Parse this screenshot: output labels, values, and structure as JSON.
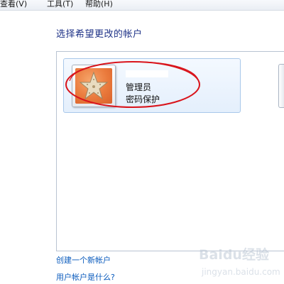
{
  "menu": {
    "items": [
      {
        "label": "查看(V)"
      },
      {
        "label": "工具(T)"
      },
      {
        "label": "帮助(H)"
      }
    ]
  },
  "heading": "选择希望更改的帐户",
  "accounts": [
    {
      "name": "管理员",
      "status": "密码保护",
      "avatar_icon": "starfish-icon"
    }
  ],
  "links": {
    "create": "创建一个新帐户",
    "what_is": "用户帐户是什么?"
  },
  "annotation": {
    "color": "#d9141b",
    "shape": "ellipse"
  },
  "watermark": {
    "brand": "Baidu经验",
    "url": "jingyan.baidu.com"
  },
  "colors": {
    "heading": "#1e3287",
    "link": "#0a5bbd",
    "tile_border": "#a9c8ea"
  }
}
